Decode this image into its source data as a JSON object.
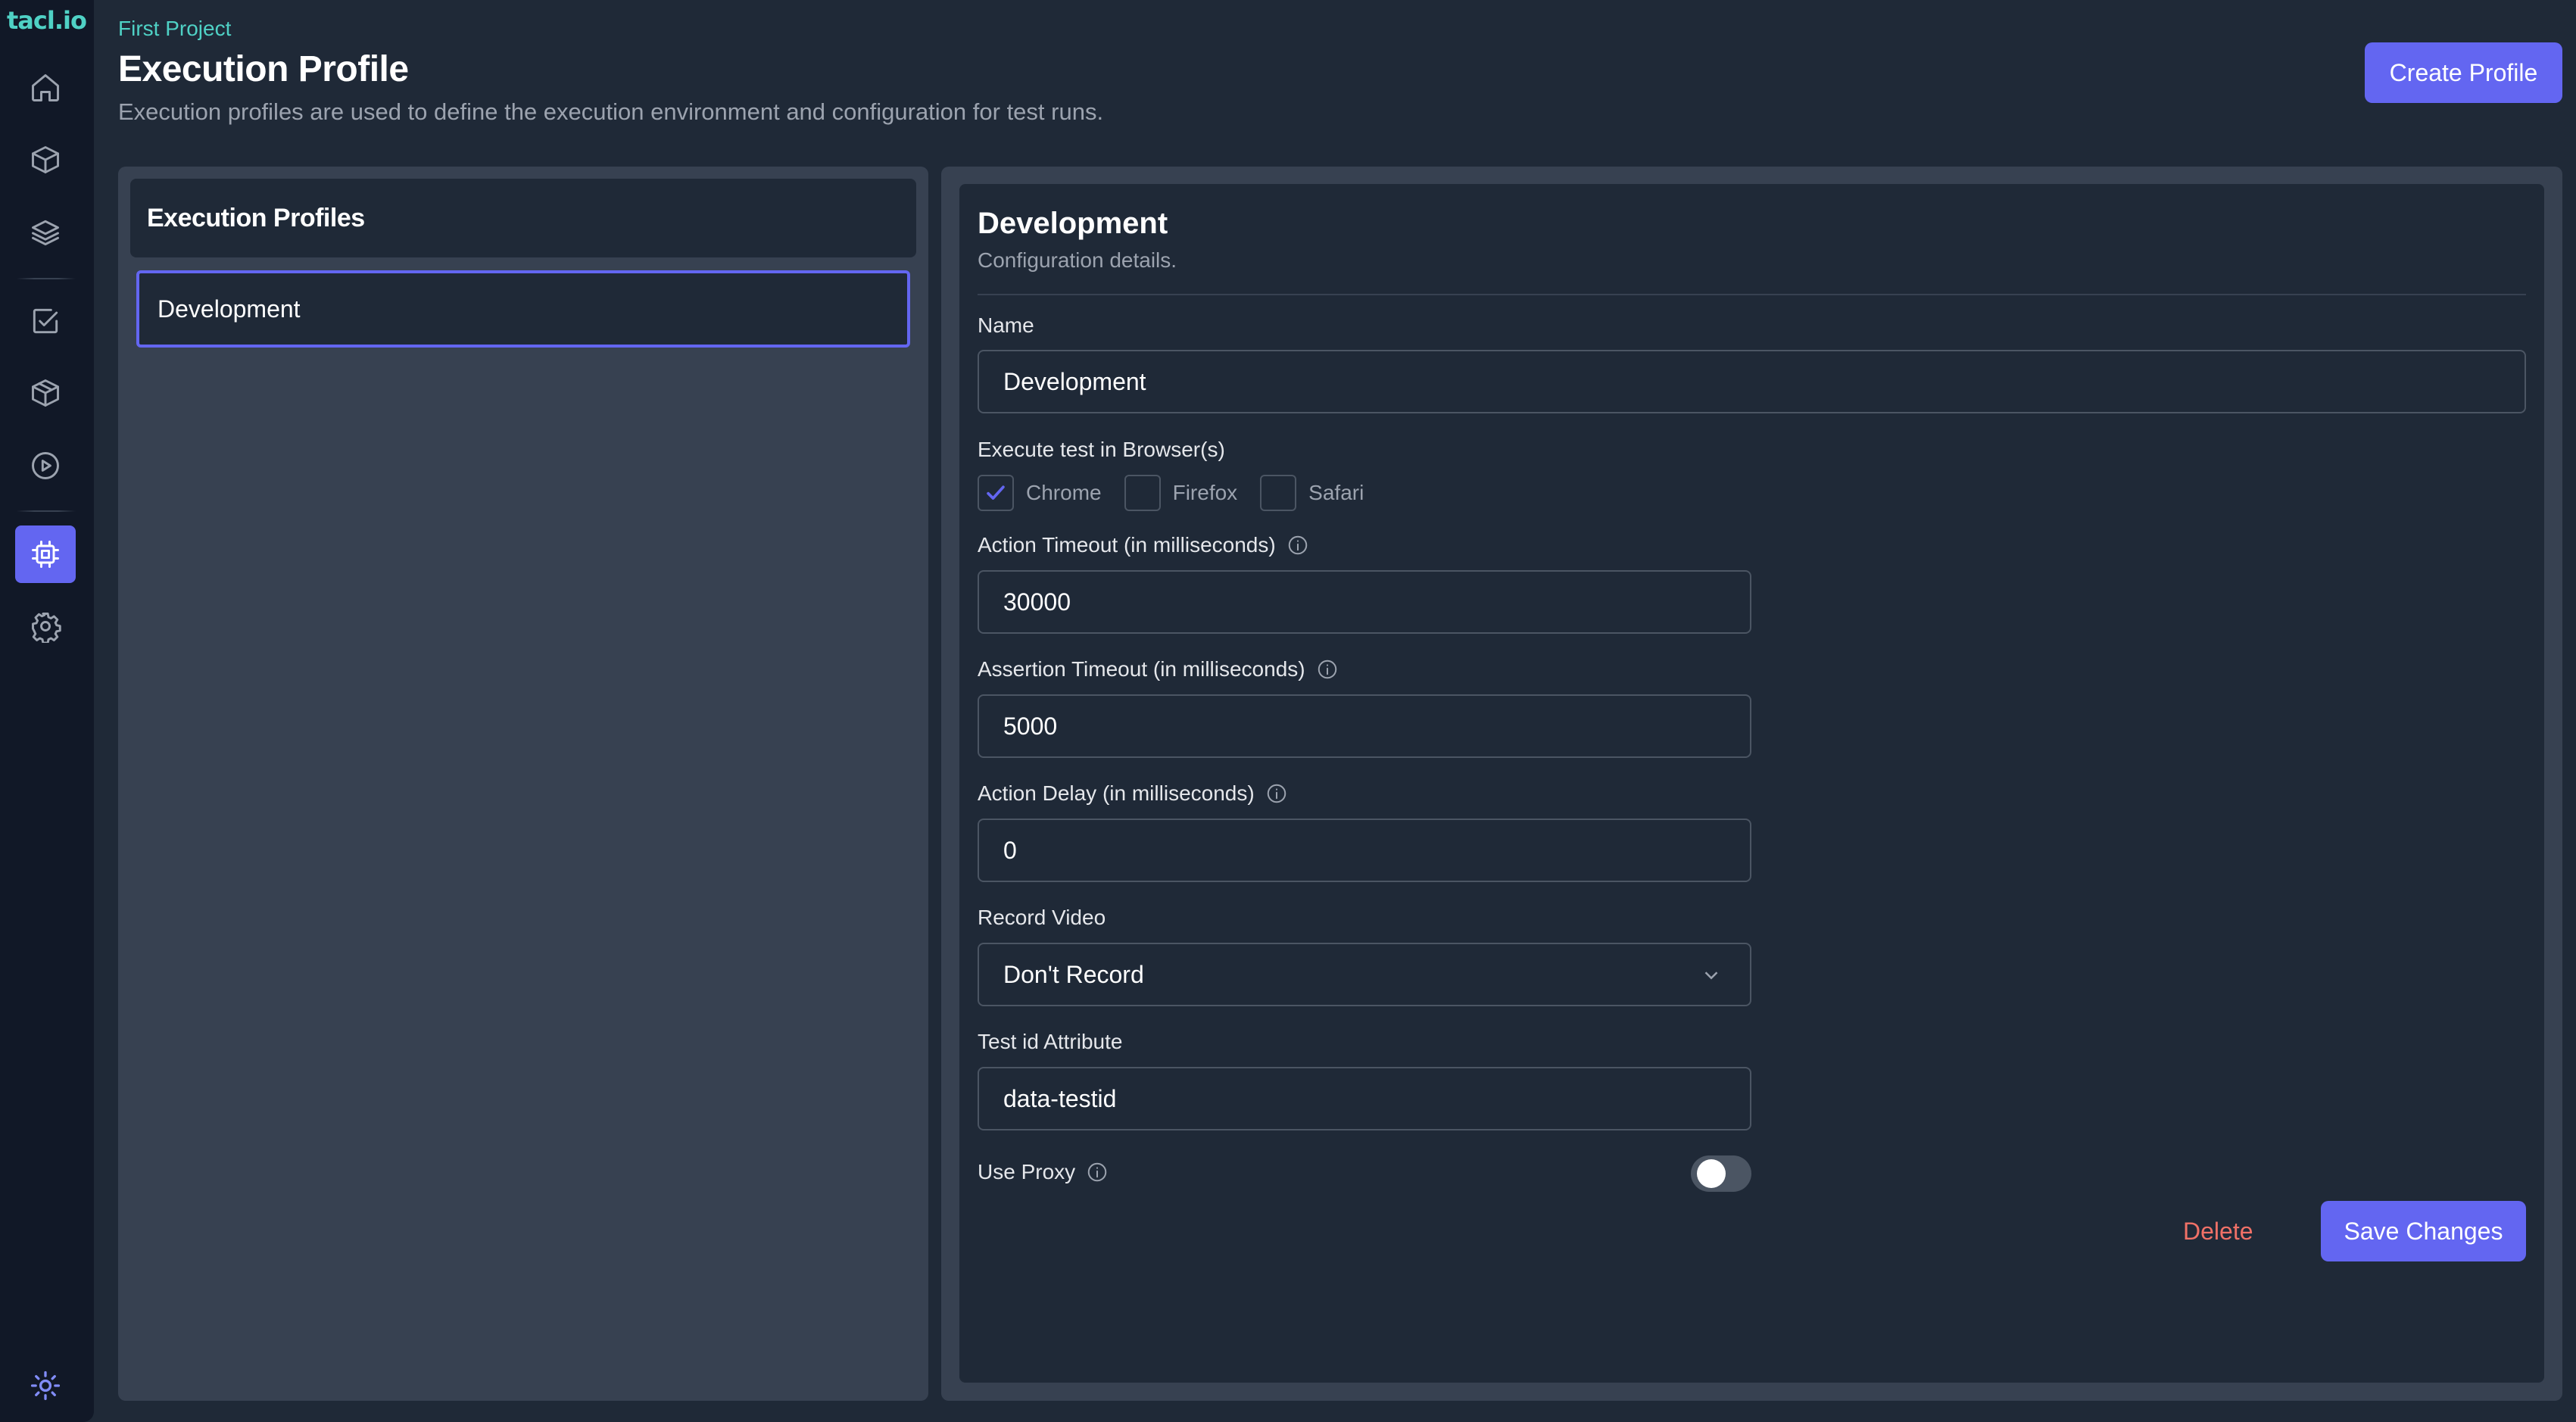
{
  "app": {
    "logo": "tacl.io"
  },
  "sidebar": {
    "items": [
      {
        "name": "home",
        "icon": "home-icon",
        "active": false
      },
      {
        "name": "components",
        "icon": "cube-icon",
        "active": false
      },
      {
        "name": "layers",
        "icon": "layers-icon",
        "active": false
      },
      {
        "name": "test-cases",
        "icon": "checkbox-icon",
        "active": false
      },
      {
        "name": "packages",
        "icon": "package-icon",
        "active": false
      },
      {
        "name": "runs",
        "icon": "play-icon",
        "active": false
      },
      {
        "name": "execution-profile",
        "icon": "chip-icon",
        "active": true
      },
      {
        "name": "settings",
        "icon": "gear-icon",
        "active": false
      }
    ],
    "theme_icon": "sun-icon"
  },
  "header": {
    "breadcrumb": "First Project",
    "title": "Execution Profile",
    "subtitle": "Execution profiles are used to define the execution environment and configuration for test runs.",
    "create_button": "Create Profile"
  },
  "profiles_list": {
    "title": "Execution Profiles",
    "items": [
      {
        "label": "Development",
        "selected": true
      }
    ]
  },
  "detail": {
    "title": "Development",
    "subtitle": "Configuration details.",
    "name": {
      "label": "Name",
      "value": "Development"
    },
    "browsers": {
      "label": "Execute test in Browser(s)",
      "options": [
        {
          "label": "Chrome",
          "checked": true
        },
        {
          "label": "Firefox",
          "checked": false
        },
        {
          "label": "Safari",
          "checked": false
        }
      ]
    },
    "action_timeout": {
      "label": "Action Timeout (in milliseconds)",
      "value": "30000"
    },
    "assertion_timeout": {
      "label": "Assertion Timeout (in milliseconds)",
      "value": "5000"
    },
    "action_delay": {
      "label": "Action Delay (in milliseconds)",
      "value": "0"
    },
    "record_video": {
      "label": "Record Video",
      "value": "Don't Record"
    },
    "test_id_attribute": {
      "label": "Test id Attribute",
      "value": "data-testid"
    },
    "use_proxy": {
      "label": "Use Proxy",
      "enabled": false
    },
    "delete_button": "Delete",
    "save_button": "Save Changes"
  },
  "colors": {
    "accent": "#6366f1",
    "brand": "#4fd1c5",
    "danger": "#f07167",
    "sidebar_bg": "#111827",
    "page_bg": "#1f2937",
    "panel_bg": "#374151"
  }
}
